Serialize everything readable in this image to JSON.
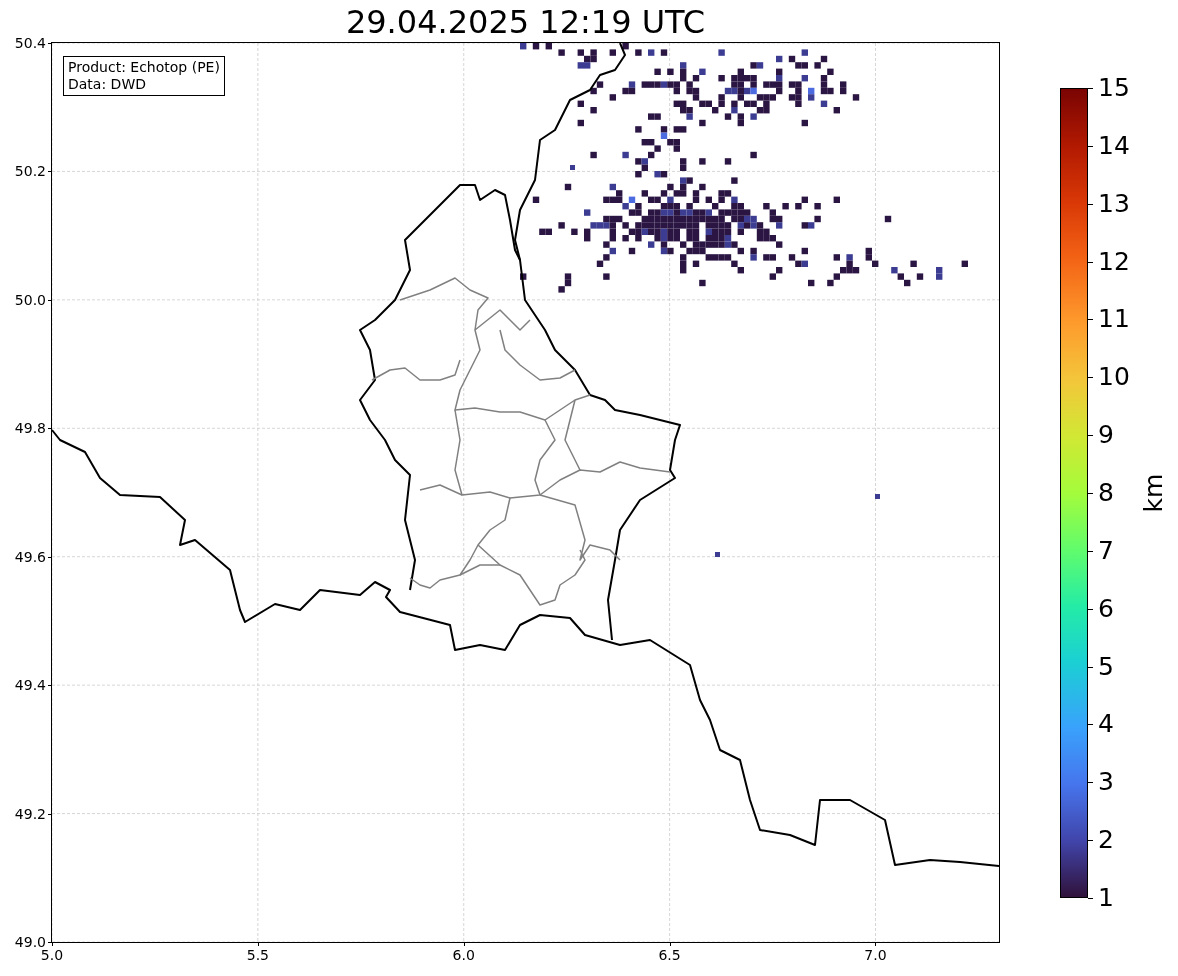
{
  "title": "29.04.2025 12:19 UTC",
  "info_box": [
    "Product: Echotop (PE)",
    "Data: DWD"
  ],
  "axes": {
    "xticks": [
      "5.0",
      "5.5",
      "6.0",
      "6.5",
      "7.0"
    ],
    "yticks": [
      "50.4",
      "50.2",
      "50.0",
      "49.8",
      "49.6",
      "49.4",
      "49.2",
      "49.0"
    ]
  },
  "colorbar": {
    "ticks": [
      "15",
      "14",
      "13",
      "12",
      "11",
      "10",
      "9",
      "8",
      "7",
      "6",
      "5",
      "4",
      "3",
      "2",
      "1"
    ],
    "label": "km"
  }
}
